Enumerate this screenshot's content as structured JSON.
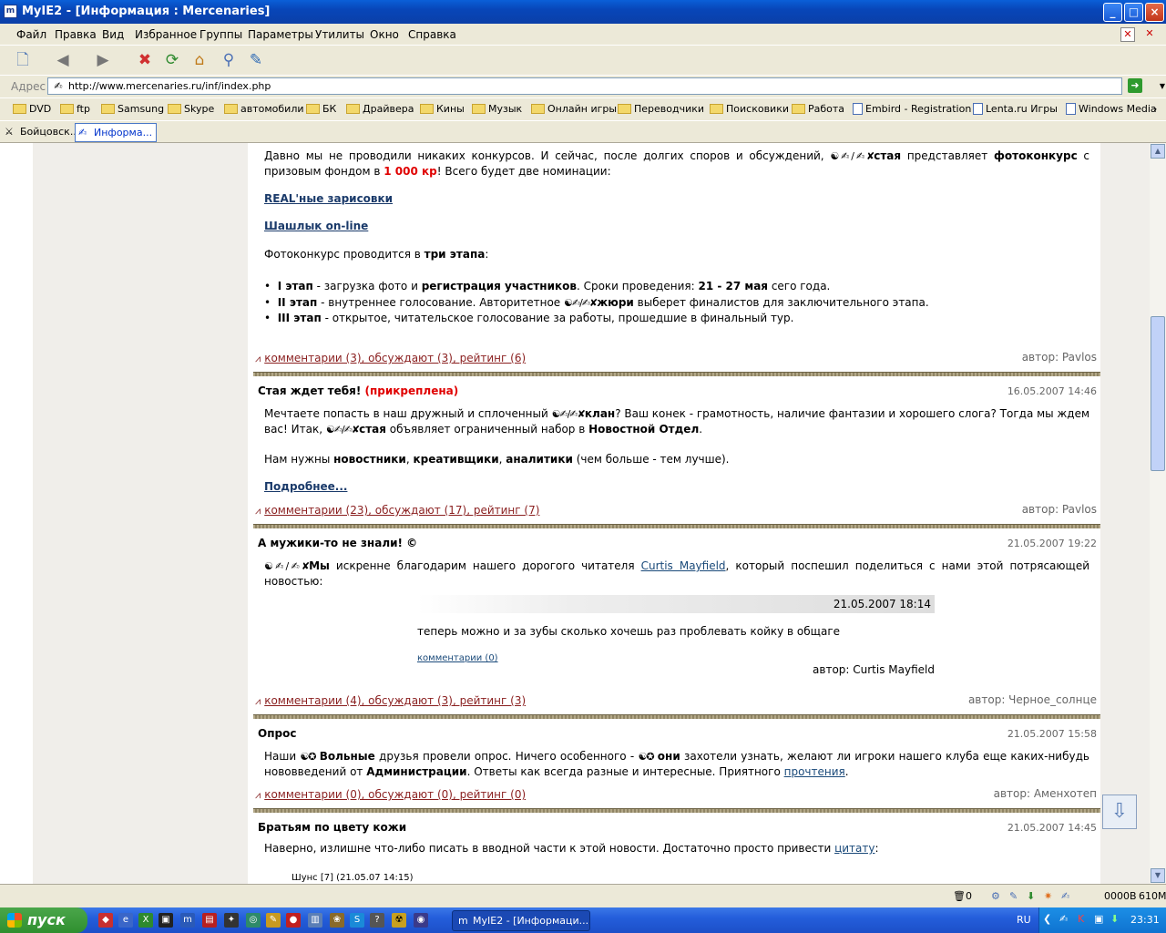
{
  "window": {
    "title": "MyIE2 - [Информация : Mercenaries]",
    "min": "_",
    "max": "□",
    "close": "×"
  },
  "menu": [
    "Файл",
    "Правка",
    "Вид",
    "Избранное",
    "Группы",
    "Параметры",
    "Утилиты",
    "Окно",
    "Справка"
  ],
  "address": {
    "label": "Адрес",
    "url": "http://www.mercenaries.ru/inf/index.php"
  },
  "links": [
    {
      "label": "DVD",
      "type": "folder"
    },
    {
      "label": "ftp",
      "type": "folder"
    },
    {
      "label": "Samsung",
      "type": "folder"
    },
    {
      "label": "Skype",
      "type": "folder"
    },
    {
      "label": "автомобили",
      "type": "folder"
    },
    {
      "label": "БК",
      "type": "folder"
    },
    {
      "label": "Драйвера",
      "type": "folder"
    },
    {
      "label": "Кины",
      "type": "folder"
    },
    {
      "label": "Музык",
      "type": "folder"
    },
    {
      "label": "Онлайн игры",
      "type": "folder"
    },
    {
      "label": "Переводчики",
      "type": "folder"
    },
    {
      "label": "Поисковики",
      "type": "folder"
    },
    {
      "label": "Работа",
      "type": "folder"
    },
    {
      "label": "Embird - Registration",
      "type": "page"
    },
    {
      "label": "Lenta.ru Игры",
      "type": "page"
    },
    {
      "label": "Windows Media",
      "type": "page"
    }
  ],
  "tabs": [
    {
      "label": "Бойцовск...",
      "active": false
    },
    {
      "label": "Информа...",
      "active": true
    }
  ],
  "post1": {
    "p1a": "Давно мы не проводили никаких конкурсов. И сейчас, после долгих споров и обсуждений, ",
    "icon": "☯✍/✍✘",
    "clan": "стая",
    "p1b": " представляет ",
    "p1c": "фотоконкурс",
    "p1d": " с призовым фондом в ",
    "prize": "1 000 кр",
    "p1e": "! Всего будет две номинации:",
    "link1": "REAL'ные зарисовки",
    "link2": "Шашлык on-line",
    "p2a": "Фотоконкурс проводится в ",
    "p2b": "три этапа",
    "p2c": ":",
    "s1a": "I этап",
    "s1b": " - загрузка фото и ",
    "s1c": "регистрация участников",
    "s1d": ". Сроки проведения: ",
    "s1e": "21 - 27 мая",
    "s1f": " сего года.",
    "s2a": "II этап",
    "s2b": " - внутреннее голосование. Авторитетное ",
    "s2c": "жюри",
    "s2d": " выберет финалистов для заключительного этапа.",
    "s3a": "III этап",
    "s3b": " - открытое, читательское голосование за работы, прошедшие в финальный тур.",
    "meta": "комментарии (3), обсуждают (3), рейтинг (6)",
    "author": "автор: Pavlos"
  },
  "post2": {
    "title": "Стая ждет тебя!",
    "pinned": "(прикреплена)",
    "date": "16.05.2007 14:46",
    "p1a": "Мечтаете попасть в наш дружный и сплоченный ",
    "clan1": "клан",
    "p1b": "? Ваш конек - грамотность, наличие фантазии и хорошего слога? Тогда мы ждем вас! Итак, ",
    "clan2": "стая",
    "p1c": " объявляет ограниченный набор в ",
    "p1d": "Новостной Отдел",
    "p1e": ".",
    "p2a": "Нам нужны ",
    "p2b": "новостники",
    "p2c": ", ",
    "p2d": "креативщики",
    "p2e": ", ",
    "p2f": "аналитики",
    "p2g": " (чем больше - тем лучше).",
    "more": "Подробнее...",
    "meta": "комментарии (23), обсуждают (17), рейтинг (7)",
    "author": "автор: Pavlos"
  },
  "post3": {
    "title": "А мужики-то не знали! ©",
    "date": "21.05.2007 19:22",
    "clan": "Мы",
    "p1a": " искренне благодарим нашего дорогого читателя ",
    "reader": "Curtis Mayfield",
    "p1b": ", который поспешил поделиться с нами этой потрясающей новостью:",
    "qdate": "21.05.2007 18:14",
    "qtext": "теперь можно и за зубы сколько хочешь раз проблевать койку в общаге",
    "qcomments": "комментарии (0)",
    "qauthor": "автор: Curtis Mayfield",
    "meta": "комментарии (4), обсуждают (3), рейтинг (3)",
    "author": "автор: Черное_солнце"
  },
  "post4": {
    "title": "Опрос",
    "date": "21.05.2007 15:58",
    "p1a": "Наши ",
    "icon": "☯✪",
    "p1b": "Вольные",
    "p1c": " друзья провели опрос. Ничего особенного - ",
    "p1d": "они",
    "p1e": " захотели узнать, желают ли игроки нашего клуба еще каких-нибудь нововведений от ",
    "p1f": "Администрации",
    "p1g": ". Ответы как всегда разные и интересные. Приятного ",
    "link": "прочтения",
    "p1h": ".",
    "meta": "комментарии (0), обсуждают (0), рейтинг (0)",
    "author": "автор: Аменхотеп"
  },
  "post5": {
    "title": "Братьям по цвету кожи",
    "date": "21.05.2007 14:45",
    "p1a": "Наверно, излишне что-либо писать в вводной части к этой новости. Достаточно просто привести ",
    "link": "цитату",
    "p1b": ":",
    "quoteline": "Шунс [7] (21.05.07 14:15)"
  },
  "status": {
    "counter": "0",
    "bytes": "0000B",
    "mem": "610M"
  },
  "taskbar": {
    "start": "пуск",
    "task": "MyIE2 - [Информаци...",
    "lang": "RU",
    "time": "23:31"
  }
}
